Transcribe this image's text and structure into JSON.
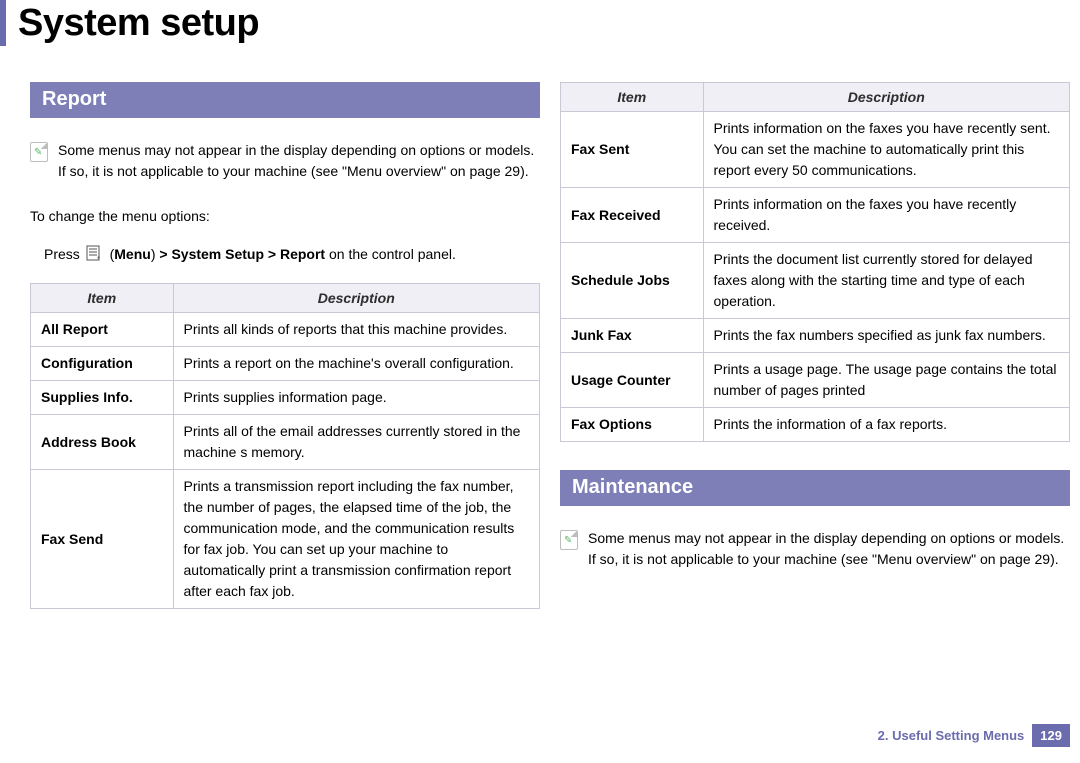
{
  "page_title": "System setup",
  "sections": {
    "report": {
      "heading": "Report",
      "note": "Some menus may not appear in the display depending on options or models. If so, it is not applicable to your machine (see \"Menu overview\" on page 29).",
      "intro": "To change the menu options:",
      "press_prefix": "Press",
      "press_menu_label": "Menu",
      "press_path": "> System Setup > Report",
      "press_suffix": " on the control panel."
    },
    "maintenance": {
      "heading": "Maintenance",
      "note": "Some menus may not appear in the display depending on options or models. If so, it is not applicable to your machine (see \"Menu overview\" on page 29)."
    }
  },
  "table_headers": {
    "item": "Item",
    "desc": "Description"
  },
  "report_rows": [
    {
      "item": "All Report",
      "desc": "Prints all kinds of reports that this machine provides."
    },
    {
      "item": "Configuration",
      "desc": "Prints a report on the machine's overall configuration."
    },
    {
      "item": "Supplies Info.",
      "desc": "Prints supplies  information page."
    },
    {
      "item": "Address Book",
      "desc": "Prints all of the email addresses currently stored in the machine s memory."
    },
    {
      "item": "Fax Send",
      "desc": "Prints a transmission report including the fax number, the number of pages, the elapsed time of the job, the communication mode, and the communication results for fax job. You can set up your machine to automatically print a transmission confirmation report after each fax job."
    }
  ],
  "right_rows": [
    {
      "item": "Fax Sent",
      "desc": "Prints information on the faxes you have recently sent. You can set the machine to automatically print this report every 50 communications."
    },
    {
      "item": "Fax Received",
      "desc": "Prints information on the faxes you have recently received."
    },
    {
      "item": "Schedule Jobs",
      "desc": "Prints the document list currently stored for delayed faxes along with the starting time and type of each operation."
    },
    {
      "item": "Junk Fax",
      "desc": "Prints the fax numbers specified as junk fax numbers."
    },
    {
      "item": "Usage Counter",
      "desc": "Prints a usage page. The usage page contains the total number of pages printed"
    },
    {
      "item": "Fax Options",
      "desc": "Prints the information of a fax reports."
    }
  ],
  "footer": {
    "chapter": "2.  Useful Setting Menus",
    "page": "129"
  }
}
